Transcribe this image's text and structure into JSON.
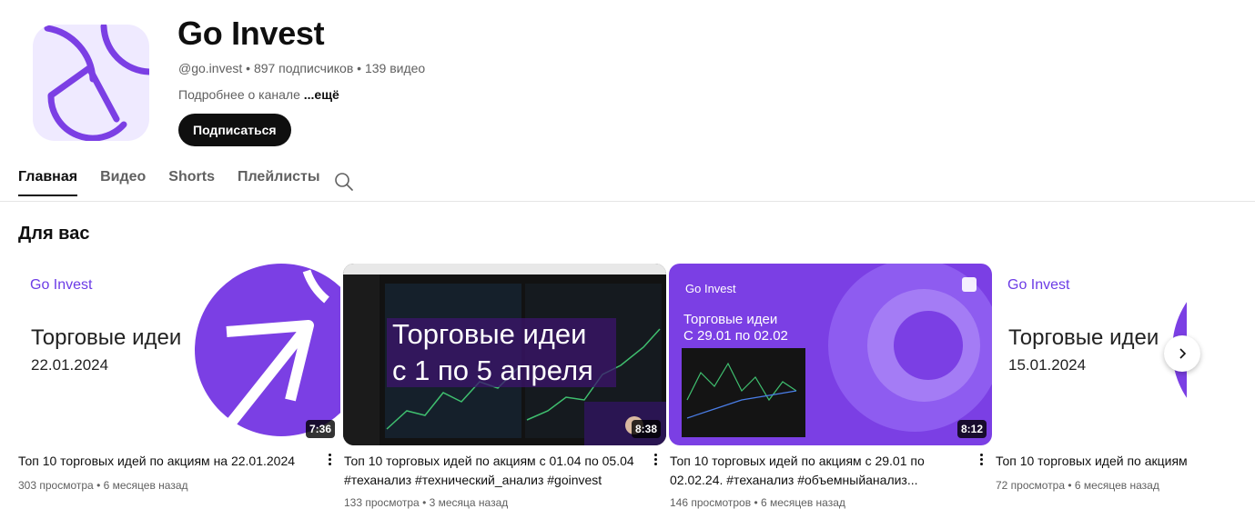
{
  "channel": {
    "name": "Go Invest",
    "handle": "@go.invest",
    "subscribers": "897 подписчиков",
    "videos_count": "139 видео",
    "about": "Подробнее о канале",
    "more": "...ещё",
    "subscribe_label": "Подписаться",
    "brand_color": "#7b3fe4"
  },
  "tabs": [
    {
      "label": "Главная",
      "active": true
    },
    {
      "label": "Видео"
    },
    {
      "label": "Shorts"
    },
    {
      "label": "Плейлисты"
    }
  ],
  "section_title": "Для вас",
  "videos": [
    {
      "title": "Топ 10 торговых идей по акциям на 22.01.2024",
      "views": "303 просмотра",
      "age": "6 месяцев назад",
      "duration": "7:36",
      "thumb_brand": "Go Invest",
      "thumb_heading": "Торговые идеи",
      "thumb_date": "22.01.2024"
    },
    {
      "title": "Топ 10 торговых идей по акциям с 01.04 по 05.04 #теханализ #технический_анализ #goinvest",
      "views": "133 просмотра",
      "age": "3 месяца назад",
      "duration": "8:38",
      "thumb_line1": "Торговые идеи",
      "thumb_line2": "с 1 по 5 апреля"
    },
    {
      "title": "Топ 10 торговых идей по акциям с 29.01 по 02.02.24. #теханализ #объемныйанализ...",
      "views": "146 просмотров",
      "age": "6 месяцев назад",
      "duration": "8:12",
      "thumb_brand": "Go Invest",
      "thumb_heading": "Торговые идеи",
      "thumb_date": "С 29.01 по 02.02"
    },
    {
      "title": "Топ 10 торговых идей по акциям",
      "views": "72 просмотра",
      "age": "6 месяцев назад",
      "thumb_brand": "Go Invest",
      "thumb_heading": "Торговые идеи",
      "thumb_date": "15.01.2024"
    }
  ],
  "meta_sep": "•"
}
